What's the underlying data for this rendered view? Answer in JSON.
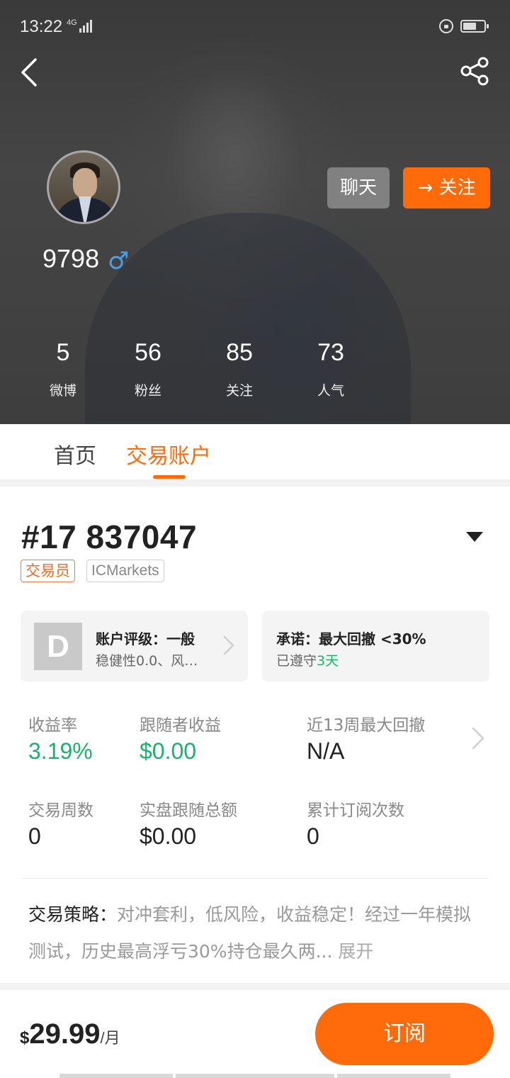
{
  "status_bar": {
    "time": "13:22",
    "network": "4G"
  },
  "header": {
    "chat_label": "聊天",
    "follow_label": "关注",
    "username": "9798",
    "gender_symbol": "♂",
    "stats": [
      {
        "value": "5",
        "label": "微博"
      },
      {
        "value": "56",
        "label": "粉丝"
      },
      {
        "value": "85",
        "label": "关注"
      },
      {
        "value": "73",
        "label": "人气"
      }
    ]
  },
  "tabs": [
    {
      "label": "首页",
      "active": false
    },
    {
      "label": "交易账户",
      "active": true
    }
  ],
  "account": {
    "number": "#17 837047",
    "tags": [
      "交易员",
      "ICMarkets"
    ],
    "rating_card": {
      "grade": "D",
      "title": "账户评级：一般",
      "subtitle": "稳健性0.0、风…"
    },
    "promise_card": {
      "title": "承诺：最大回撤 <30%",
      "subtitle_prefix": "已遵守",
      "subtitle_highlight": "3天"
    },
    "metrics": [
      {
        "label": "收益率",
        "value": "3.19%",
        "highlight": true
      },
      {
        "label": "跟随者收益",
        "value": "$0.00",
        "highlight": true
      },
      {
        "label": "近13周最大回撤",
        "value": "N/A",
        "highlight": false
      },
      {
        "label": "交易周数",
        "value": "0",
        "highlight": false
      },
      {
        "label": "实盘跟随总额",
        "value": "$0.00",
        "highlight": false
      },
      {
        "label": "累计订阅次数",
        "value": "0",
        "highlight": false
      }
    ],
    "strategy": {
      "label": "交易策略：",
      "text": "对冲套利，低风险，收益稳定！经过一年模拟测试，历史最高浮亏30%持仓最久两...",
      "expand_label": "展开"
    }
  },
  "bottom_bar": {
    "currency": "$",
    "price": "29.99",
    "unit": "/月",
    "subscribe_label": "订阅"
  },
  "colors": {
    "accent": "#ff6a0a",
    "positive": "#1bb36b",
    "male": "#4a9ee8"
  }
}
